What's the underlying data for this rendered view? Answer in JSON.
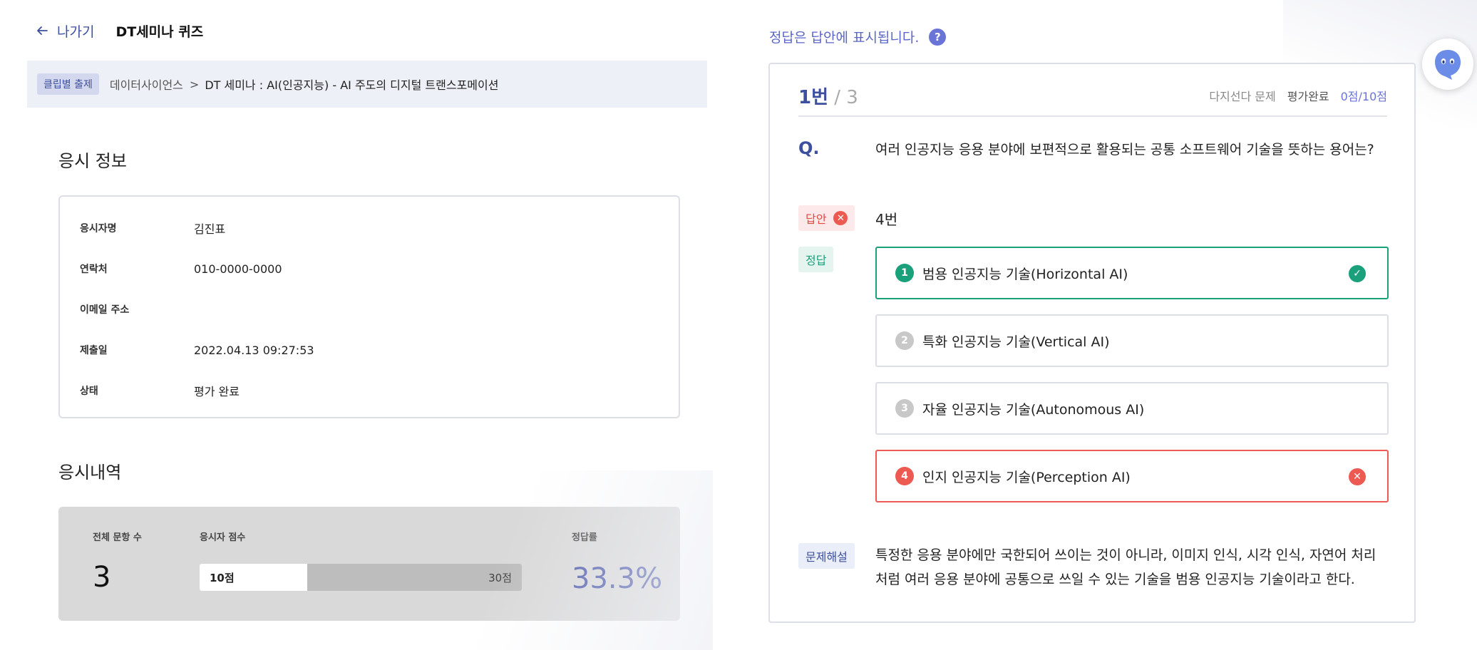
{
  "topbar": {
    "back_label": "나가기",
    "quiz_title": "DT세미나 퀴즈"
  },
  "breadcrumb": {
    "badge": "클립별 출제",
    "category": "데이터사이언스",
    "separator": ">",
    "item": "DT 세미나 : AI(인공지능) - AI 주도의 디지털 트랜스포메이션"
  },
  "exam_info": {
    "title": "응시 정보",
    "rows": [
      {
        "label": "응시자명",
        "value": "김진표"
      },
      {
        "label": "연락처",
        "value": "010-0000-0000"
      },
      {
        "label": "이메일 주소",
        "value": ""
      },
      {
        "label": "제출일",
        "value": "2022.04.13 09:27:53"
      },
      {
        "label": "상태",
        "value": "평가 완료"
      }
    ]
  },
  "history": {
    "title": "응시내역",
    "total_label": "전체 문항 수",
    "total_value": "3",
    "score_label": "응시자 점수",
    "score_value": "10점",
    "score_max": "30점",
    "score_fraction": 0.333,
    "rate_label": "정답률",
    "rate_value": "33.3%"
  },
  "notice": {
    "text": "정답은 답안에 표시됩니다.",
    "help": "?"
  },
  "question": {
    "current": "1번",
    "total": " / 3",
    "type": "다지선다 문제",
    "status": "평가완료",
    "score": "0점/10점",
    "prefix": "Q.",
    "text": "여러 인공지능 응용 분야에 보편적으로 활용되는 공통 소프트웨어 기술을 뜻하는 용어는?",
    "answer_tag": "답안",
    "answer_mark": "✕",
    "answer_value": "4번",
    "correct_tag": "정답",
    "options": [
      {
        "num": "1",
        "text": "범용 인공지능 기술(Horizontal AI)",
        "state": "correct",
        "mark": "✓"
      },
      {
        "num": "2",
        "text": "특화 인공지능 기술(Vertical AI)",
        "state": "normal",
        "mark": ""
      },
      {
        "num": "3",
        "text": "자율 인공지능 기술(Autonomous AI)",
        "state": "normal",
        "mark": ""
      },
      {
        "num": "4",
        "text": "인지 인공지능 기술(Perception AI)",
        "state": "wrong",
        "mark": "✕"
      }
    ],
    "explain_tag": "문제해설",
    "explanation": "특정한 응용 분야에만 국한되어 쓰이는 것이 아니라, 이미지 인식, 시각 인식, 자연어 처리 처럼 여러 응용 분야에 공통으로 쓰일 수 있는 기술을 범용 인공지능 기술이라고 한다."
  },
  "colors": {
    "accent": "#3d4f9f",
    "link": "#6a74d6",
    "correct": "#1aa07a",
    "wrong": "#ec5a52"
  }
}
